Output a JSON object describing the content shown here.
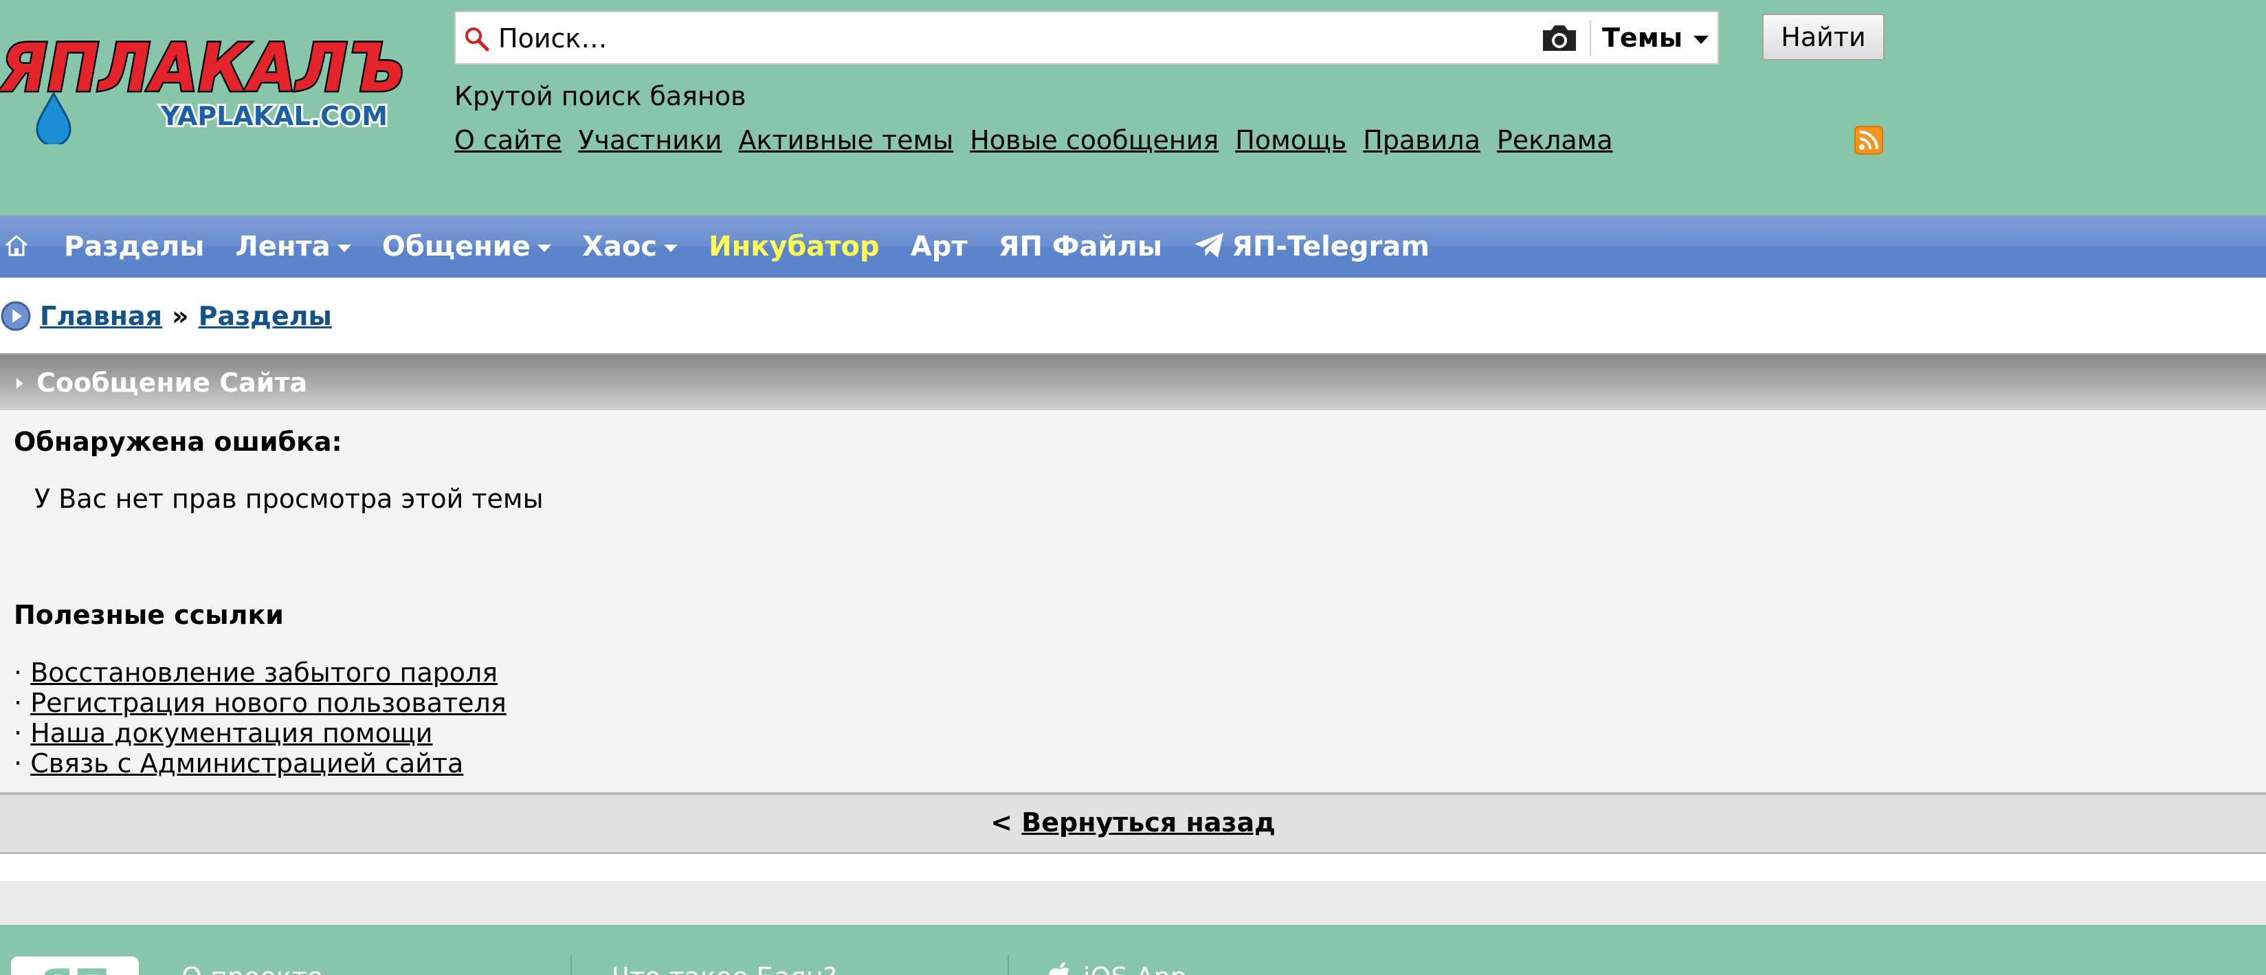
{
  "header": {
    "logo": {
      "main_text": "ЯПЛАКАЛЪ",
      "sub_text": "YAPLAKAL.COM"
    },
    "search": {
      "placeholder": "Поиск…",
      "scope_label": "Темы",
      "button_label": "Найти"
    },
    "tagline": "Крутой поиск баянов",
    "links": [
      "О сайте",
      "Участники",
      "Активные темы",
      "Новые сообщения",
      "Помощь",
      "Правила",
      "Реклама"
    ]
  },
  "nav": {
    "items": [
      {
        "label": "Разделы"
      },
      {
        "label": "Лента"
      },
      {
        "label": "Общение"
      },
      {
        "label": "Хаос"
      },
      {
        "label": "Инкубатор"
      },
      {
        "label": "Арт"
      },
      {
        "label": "ЯП Файлы"
      },
      {
        "label": "ЯП-Telegram"
      }
    ]
  },
  "breadcrumb": {
    "home": "Главная",
    "separator": "»",
    "current": "Разделы"
  },
  "message": {
    "title": "Сообщение Сайта",
    "error_heading": "Обнаружена ошибка:",
    "error_text": "У Вас нет прав просмотра этой темы",
    "links_heading": "Полезные ссылки",
    "bullet": "·",
    "links": [
      "Восстановление забытого пароля",
      "Регистрация нового пользователя",
      "Наша документация помощи",
      "Связь с Администрацией сайта"
    ],
    "back_prefix": "<",
    "back_label": "Вернуться назад"
  },
  "footer": {
    "logo_text": "ЯП",
    "links": [
      "О проекте",
      "Что такое Баян?",
      "iOS App"
    ]
  },
  "colors": {
    "header_bg": "#87c6a8",
    "nav_bg": "#5b84cc",
    "nav_accent": "#ffff55",
    "breadcrumb_link": "#155289",
    "message_bg": "#f4f4f4",
    "rss_orange": "#f7941e",
    "logo_red": "#e3252b",
    "logo_blue": "#1a5fa8"
  },
  "icons": {
    "search": "search-icon",
    "camera": "camera-icon",
    "rss": "rss-icon",
    "home": "home-icon",
    "telegram": "telegram-icon",
    "breadcrumb": "play-circle-icon",
    "apple": "apple-icon"
  }
}
